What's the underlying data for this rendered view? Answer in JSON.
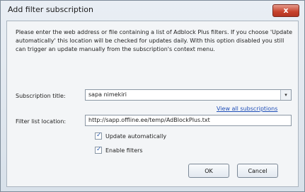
{
  "window": {
    "title": "Add filter subscription",
    "close_label": "x"
  },
  "description": "Please enter the web address or file containing a list of Adblock Plus filters. If you choose 'Update automatically' this location will be checked for updates daily. With this option disabled you still can trigger an update manually from the subscription's context menu.",
  "form": {
    "title_label": "Subscription title:",
    "title_value": "sapa nimekiri",
    "dropdown_glyph": "▾",
    "view_all_link": "View all subscriptions",
    "location_label": "Filter list location:",
    "location_value": "http://sapp.offline.ee/temp/AdBlockPlus.txt",
    "update_label": "Update automatically",
    "update_checked": true,
    "enable_label": "Enable filters",
    "enable_checked": true
  },
  "buttons": {
    "ok": "OK",
    "cancel": "Cancel"
  }
}
